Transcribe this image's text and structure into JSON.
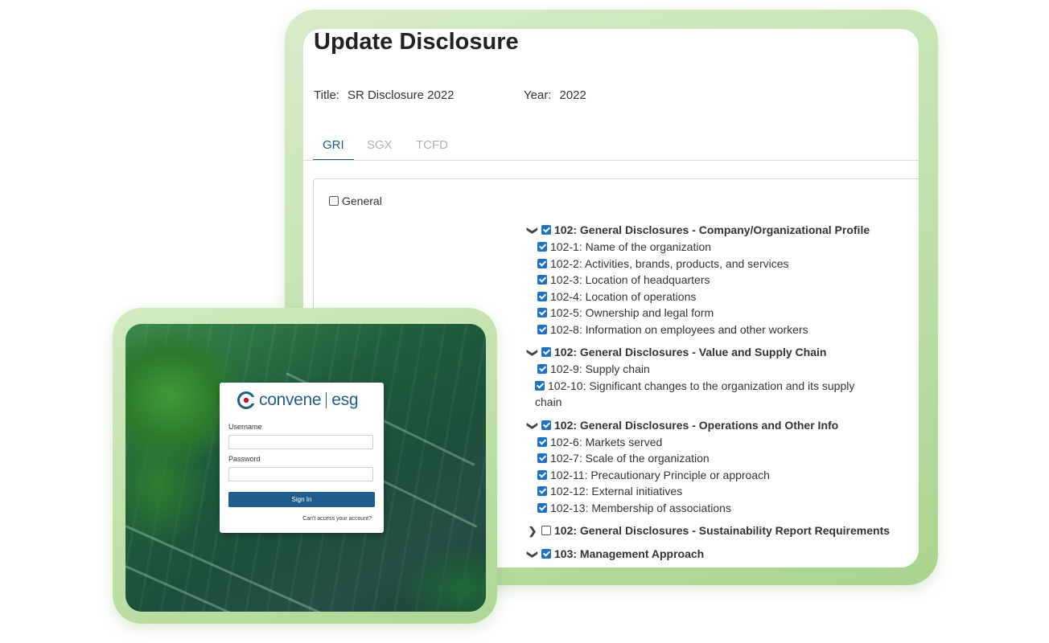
{
  "disclosure": {
    "title": "Update Disclosure",
    "title_label": "Title:",
    "title_value": "SR Disclosure 2022",
    "year_label": "Year:",
    "year_value": "2022",
    "tabs": [
      {
        "label": "GRI",
        "active": true
      },
      {
        "label": "SGX",
        "active": false
      },
      {
        "label": "TCFD",
        "active": false
      }
    ],
    "general_label": "General",
    "groups": [
      {
        "label": "102: General Disclosures - Company/Organizational Profile",
        "expanded": true,
        "checked": true,
        "items": [
          {
            "code": "102-1",
            "text": "Name of the organization"
          },
          {
            "code": "102-2",
            "text": "Activities, brands, products, and services"
          },
          {
            "code": "102-3",
            "text": "Location of headquarters"
          },
          {
            "code": "102-4",
            "text": "Location of operations"
          },
          {
            "code": "102-5",
            "text": "Ownership and legal form"
          },
          {
            "code": "102-8",
            "text": "Information on employees and other workers"
          }
        ]
      },
      {
        "label": "102: General Disclosures - Value and Supply Chain",
        "expanded": true,
        "checked": true,
        "items": [
          {
            "code": "102-9",
            "text": "Supply chain"
          },
          {
            "code": "102-10",
            "text": "Significant changes to the organization and its supply chain"
          }
        ]
      },
      {
        "label": "102: General Disclosures - Operations and Other Info",
        "expanded": true,
        "checked": true,
        "items": [
          {
            "code": "102-6",
            "text": "Markets served"
          },
          {
            "code": "102-7",
            "text": "Scale of the organization"
          },
          {
            "code": "102-11",
            "text": "Precautionary Principle or approach"
          },
          {
            "code": "102-12",
            "text": "External initiatives"
          },
          {
            "code": "102-13",
            "text": "Membership of associations"
          }
        ]
      },
      {
        "label": "102: General Disclosures - Sustainability Report Requirements",
        "expanded": false,
        "checked": false,
        "items": []
      },
      {
        "label": "103: Management Approach",
        "expanded": true,
        "checked": true,
        "items": []
      }
    ]
  },
  "login": {
    "logo_left": "convene",
    "logo_right": "esg",
    "username_label": "Username",
    "password_label": "Password",
    "signin_label": "Sign In",
    "forgot_label": "Can't access your account?"
  },
  "colors": {
    "accent": "#1f5d8c",
    "checkbox": "#1a73c8",
    "frame_green": "#bfe0a9"
  }
}
